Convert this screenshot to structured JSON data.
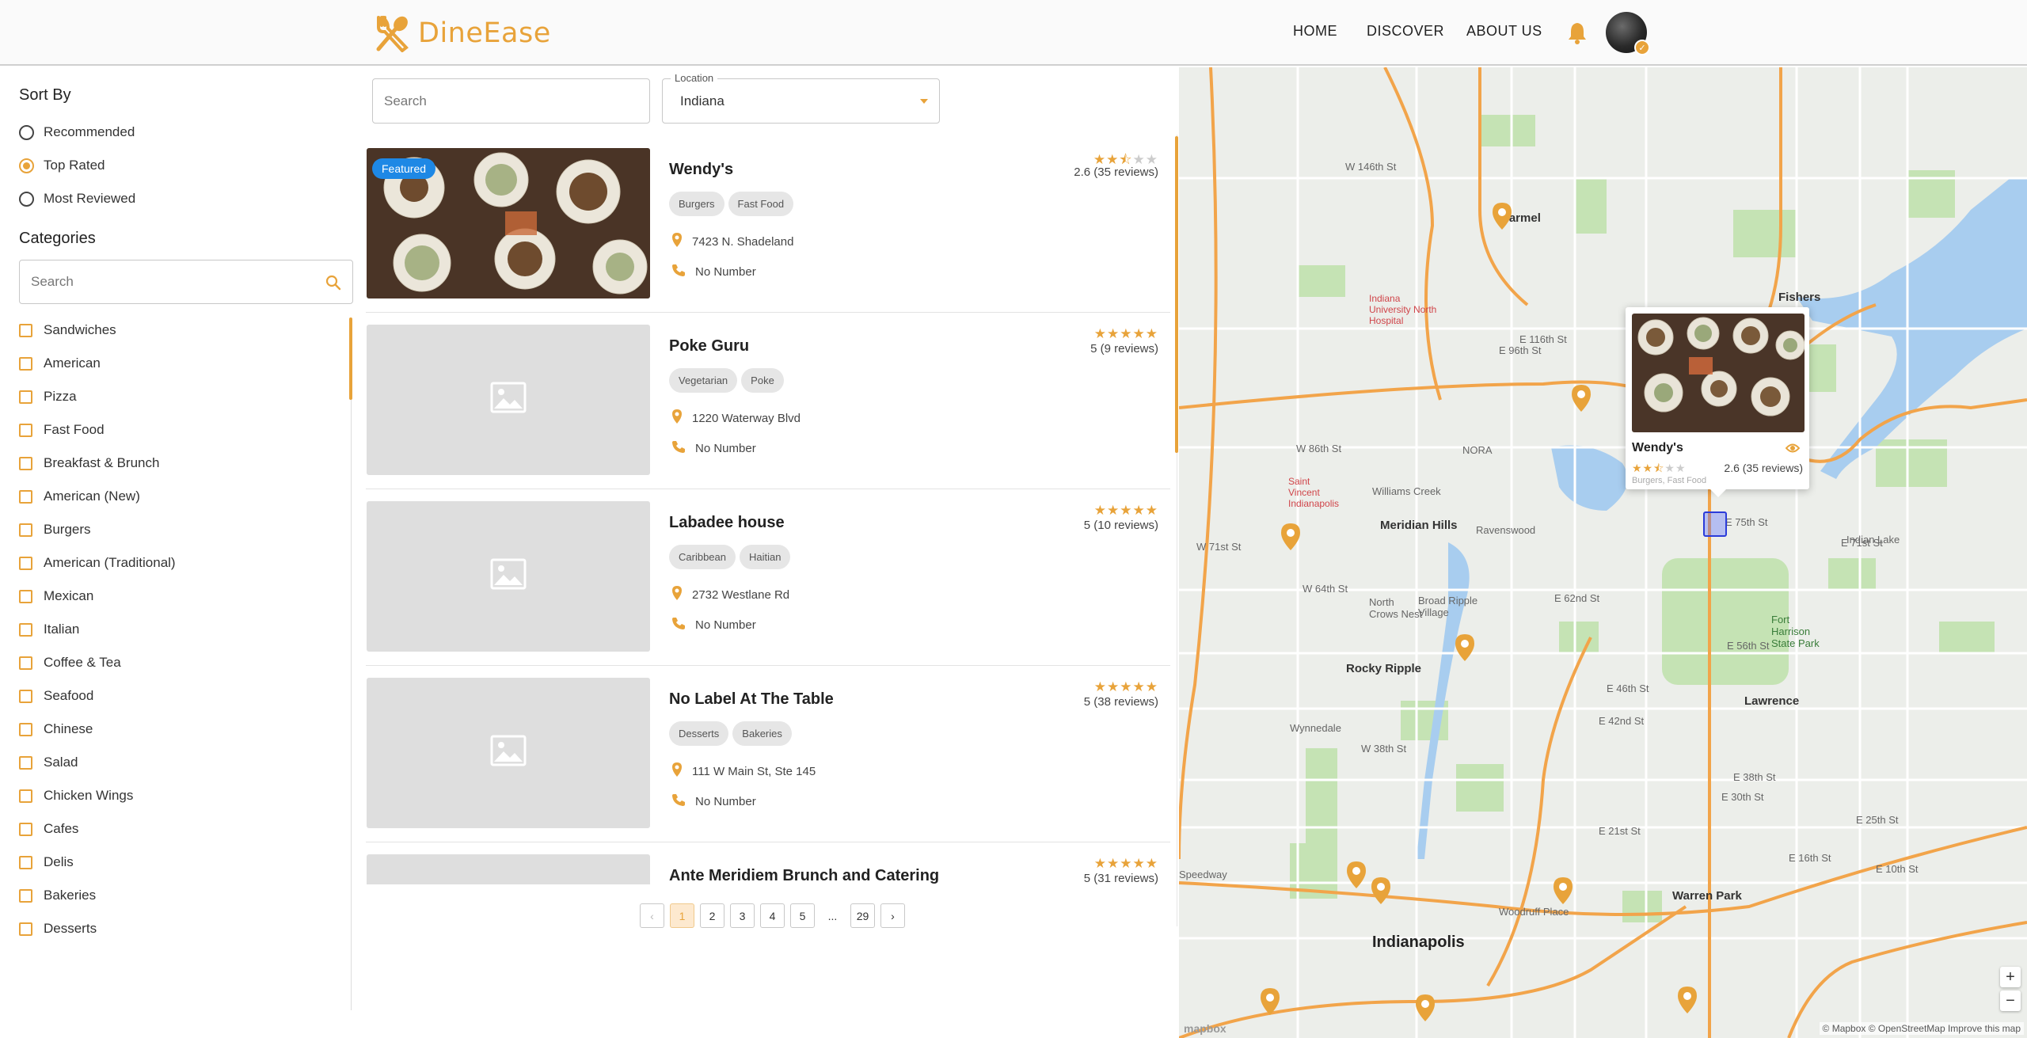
{
  "app": {
    "name": "DineEase"
  },
  "nav": {
    "home": "HOME",
    "discover": "DISCOVER",
    "about": "ABOUT US"
  },
  "sidebar": {
    "sort_heading": "Sort By",
    "sort_options": [
      {
        "label": "Recommended",
        "checked": false
      },
      {
        "label": "Top Rated",
        "checked": true
      },
      {
        "label": "Most Reviewed",
        "checked": false
      }
    ],
    "categories_heading": "Categories",
    "category_search_placeholder": "Search",
    "categories": [
      "Sandwiches",
      "American",
      "Pizza",
      "Fast Food",
      "Breakfast & Brunch",
      "American (New)",
      "Burgers",
      "American (Traditional)",
      "Mexican",
      "Italian",
      "Coffee & Tea",
      "Seafood",
      "Chinese",
      "Salad",
      "Chicken Wings",
      "Cafes",
      "Delis",
      "Bakeries",
      "Desserts"
    ]
  },
  "search": {
    "placeholder": "Search"
  },
  "location": {
    "label": "Location",
    "value": "Indiana"
  },
  "restaurants": [
    {
      "name": "Wendy's",
      "tags": [
        "Burgers",
        "Fast Food"
      ],
      "address": "7423 N. Shadeland",
      "phone": "No Number",
      "rating": 2.6,
      "rating_text": "2.6 (35 reviews)",
      "featured": "Featured",
      "has_photo": true
    },
    {
      "name": "Poke Guru",
      "tags": [
        "Vegetarian",
        "Poke"
      ],
      "address": "1220 Waterway Blvd",
      "phone": "No Number",
      "rating": 5,
      "rating_text": "5 (9 reviews)",
      "has_photo": false
    },
    {
      "name": "Labadee house",
      "tags": [
        "Caribbean",
        "Haitian"
      ],
      "address": "2732 Westlane Rd",
      "phone": "No Number",
      "rating": 5,
      "rating_text": "5 (10 reviews)",
      "has_photo": false
    },
    {
      "name": "No Label At The Table",
      "tags": [
        "Desserts",
        "Bakeries"
      ],
      "address": "111 W Main St, Ste 145",
      "phone": "No Number",
      "rating": 5,
      "rating_text": "5 (38 reviews)",
      "has_photo": false
    },
    {
      "name": "Ante Meridiem Brunch and Catering",
      "tags": [],
      "address": "",
      "phone": "",
      "rating": 5,
      "rating_text": "5 (31 reviews)",
      "has_photo": false
    }
  ],
  "pagination": {
    "pages": [
      "1",
      "2",
      "3",
      "4",
      "5",
      "...",
      "29"
    ],
    "current": "1",
    "prev": "‹",
    "next": "›"
  },
  "map": {
    "popup": {
      "name": "Wendy's",
      "rating": 2.6,
      "rating_text": "2.6 (35 reviews)",
      "tags": "Burgers, Fast Food"
    },
    "labels": {
      "carmel": "Carmel",
      "fishers": "Fishers",
      "indianapolis": "Indianapolis",
      "lawrence": "Lawrence",
      "warren_park": "Warren Park",
      "meridian_hills": "Meridian Hills",
      "williams_creek": "Williams Creek",
      "rocky_ripple": "Rocky Ripple",
      "nora": "NORA",
      "ravenswood": "Ravenswood",
      "speedway": "Speedway",
      "broad_ripple": "Broad Ripple Village",
      "north_crows_nest": "North Crows Nest",
      "wynnedale": "Wynnedale",
      "woodruff": "Woodruff Place",
      "indian_lake": "Indian Lake",
      "fort_harrison": "Fort Harrison State Park",
      "iu_hospital": "Indiana University North Hospital",
      "st_vincent": "Saint Vincent Indianapolis",
      "e_75th": "E 75th St",
      "e_56th": "E 56th St",
      "e_38th": "E 38th St",
      "w_86th": "W 86th St",
      "w_146th": "W 146th St",
      "e_116th": "E 116th St",
      "e_96th": "E 96th St",
      "e_62nd": "E 62nd St",
      "e_30th": "E 30th St",
      "e_25th": "E 25th St",
      "e_10th": "E 10th St",
      "w_38th": "W 38th St",
      "w_71st": "W 71st St",
      "w_64th": "W 64th St",
      "e_71st": "E 71st St",
      "e_46th": "E 46th St",
      "e_42nd": "E 42nd St",
      "e_21st": "E 21st St",
      "e_16th": "E 16th St"
    },
    "zoom_in": "+",
    "zoom_out": "−",
    "attribution": "© Mapbox © OpenStreetMap  Improve this map",
    "logo": "mapbox"
  },
  "colors": {
    "accent": "#e8a33a",
    "featured": "#1e88e5",
    "highway": "#f2a44a",
    "water": "#a8cdef",
    "park": "#c5e3b4"
  }
}
